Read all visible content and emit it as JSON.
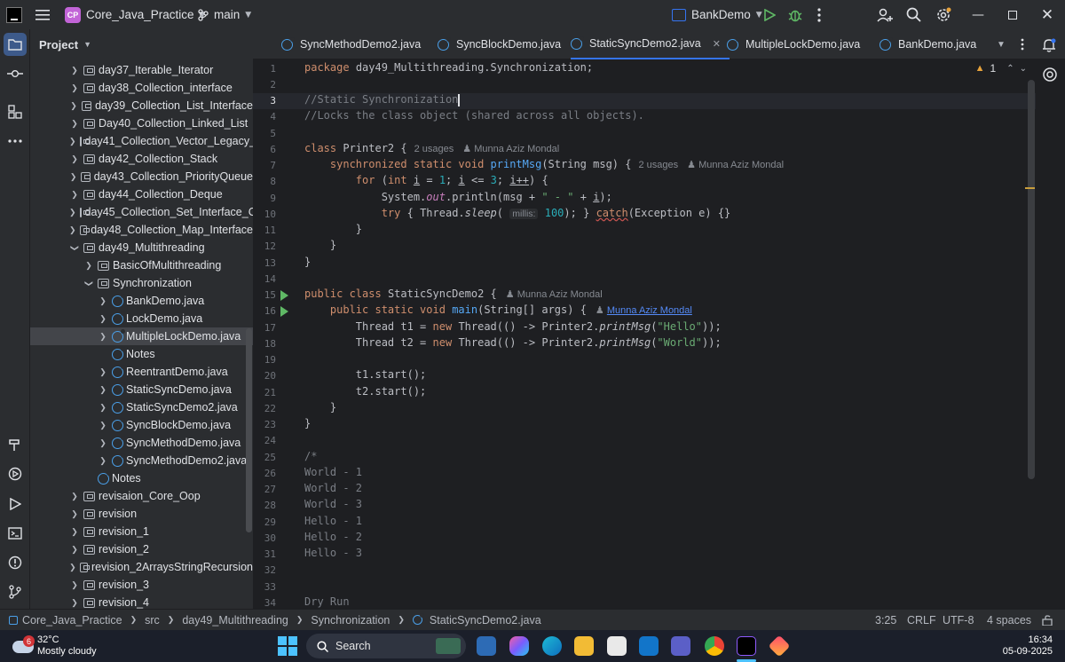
{
  "titlebar": {
    "project_badge": "CP",
    "project_name": "Core_Java_Practice",
    "branch": "main",
    "run_config": "BankDemo"
  },
  "project_panel": {
    "title": "Project",
    "rows": [
      {
        "label": "day37_Iterable_Iterator",
        "kind": "folder"
      },
      {
        "label": "day38_Collection_interface",
        "kind": "folder"
      },
      {
        "label": "day39_Collection_List_Interface",
        "kind": "folder"
      },
      {
        "label": "Day40_Collection_Linked_List",
        "kind": "folder"
      },
      {
        "label": "day41_Collection_Vector_Legacy_C",
        "kind": "folder"
      },
      {
        "label": "day42_Collection_Stack",
        "kind": "folder"
      },
      {
        "label": "day43_Collection_PriorityQueue",
        "kind": "folder"
      },
      {
        "label": "day44_Collection_Deque",
        "kind": "folder"
      },
      {
        "label": "day45_Collection_Set_Interface_C",
        "kind": "folder"
      },
      {
        "label": "day48_Collection_Map_Interface",
        "kind": "folder"
      },
      {
        "label": "day49_Multithreading",
        "kind": "folder"
      },
      {
        "label": "BasicOfMultithreading",
        "kind": "folder"
      },
      {
        "label": "Synchronization",
        "kind": "folder"
      },
      {
        "label": "BankDemo.java",
        "kind": "java"
      },
      {
        "label": "LockDemo.java",
        "kind": "java"
      },
      {
        "label": "MultipleLockDemo.java",
        "kind": "java"
      },
      {
        "label": "Notes",
        "kind": "notes"
      },
      {
        "label": "ReentrantDemo.java",
        "kind": "java"
      },
      {
        "label": "StaticSyncDemo.java",
        "kind": "java"
      },
      {
        "label": "StaticSyncDemo2.java",
        "kind": "java"
      },
      {
        "label": "SyncBlockDemo.java",
        "kind": "java"
      },
      {
        "label": "SyncMethodDemo.java",
        "kind": "java"
      },
      {
        "label": "SyncMethodDemo2.java",
        "kind": "java"
      },
      {
        "label": "Notes",
        "kind": "notes"
      },
      {
        "label": "revisaion_Core_Oop",
        "kind": "folder"
      },
      {
        "label": "revision",
        "kind": "folder"
      },
      {
        "label": "revision_1",
        "kind": "folder"
      },
      {
        "label": "revision_2",
        "kind": "folder"
      },
      {
        "label": "revision_2ArraysStringRecursion",
        "kind": "folder"
      },
      {
        "label": "revision_3",
        "kind": "folder"
      },
      {
        "label": "revision_4",
        "kind": "folder"
      }
    ]
  },
  "tabs": [
    {
      "label": "SyncMethodDemo2.java"
    },
    {
      "label": "SyncBlockDemo.java"
    },
    {
      "label": "StaticSyncDemo2.java"
    },
    {
      "label": "MultipleLockDemo.java"
    },
    {
      "label": "BankDemo.java"
    }
  ],
  "editor": {
    "warning_count": "1",
    "line_numbers": [
      "1",
      "2",
      "3",
      "4",
      "5",
      "6",
      "7",
      "8",
      "9",
      "10",
      "11",
      "12",
      "13",
      "14",
      "15",
      "16",
      "17",
      "18",
      "19",
      "20",
      "21",
      "22",
      "23",
      "24",
      "25",
      "26",
      "27",
      "28",
      "29",
      "30",
      "31",
      "32",
      "33",
      "34"
    ],
    "c_package": "package",
    "c_package_name": "day49_Multithreading.Synchronization;",
    "c_comment1": "//Static Synchronization",
    "c_comment2": "//Locks the class object (shared across all objects).",
    "c_class": "class",
    "c_printer2": "Printer2 {",
    "c_usages": "2 usages",
    "c_author": "Munna Aziz Mondal",
    "c_synchronized": "synchronized static void",
    "c_printmsg": "printMsg",
    "c_printmsg_args": "(String msg) {",
    "c_for": "for",
    "c_for_open": "(",
    "c_int": "int",
    "c_i": "i",
    "c_eq": "=",
    "c_one": "1",
    "c_lte": "<=",
    "c_three": "3",
    "c_inc": "i++",
    "c_for_close": ") {",
    "c_println_pre": "System.",
    "c_out": "out",
    "c_println_mid": ".println(msg +",
    "c_sep": "\" - \"",
    "c_plus": "+",
    "c_close_paren": ");",
    "c_try": "try",
    "c_thread_sleep": "{ Thread.",
    "c_sleep": "sleep",
    "c_millis": "millis:",
    "c_hundred": "100",
    "c_catch": "catch",
    "c_catch_rest": "(Exception e) {}",
    "c_brace_close": "}",
    "c_public_class": "public class",
    "c_classname": "StaticSyncDemo2 {",
    "c_public_static": "public static void",
    "c_main": "main",
    "c_main_args": "(String[] args) {",
    "c_t1_pre": "Thread t1 =",
    "c_new": "new",
    "c_thread_lambda": "Thread(() -> Printer2.",
    "c_printmsg_call": "printMsg",
    "c_hello": "\"Hello\"",
    "c_world": "\"World\"",
    "c_call_close": "));",
    "c_t2_pre": "Thread t2 =",
    "c_t1_start": "t1.start();",
    "c_t2_start": "t2.start();",
    "c_block_start": "/*",
    "out_lines": [
      "World - 1",
      "World - 2",
      "World - 3",
      "Hello - 1",
      "Hello - 2",
      "Hello - 3"
    ],
    "c_dry_run": "Dry Run"
  },
  "statusbar": {
    "crumbs": [
      "Core_Java_Practice",
      "src",
      "day49_Multithreading",
      "Synchronization",
      "StaticSyncDemo2.java"
    ],
    "position": "3:25",
    "line_sep": "CRLF",
    "encoding": "UTF-8",
    "indent": "4 spaces"
  },
  "taskbar": {
    "weather_badge": "6",
    "temperature": "32°C",
    "weather": "Mostly cloudy",
    "search": "Search",
    "time": "16:34",
    "date": "05-09-2025"
  },
  "colors": {
    "accent": "#3574f0",
    "project_badge": "#c264d7",
    "run_green": "#5fb865"
  }
}
